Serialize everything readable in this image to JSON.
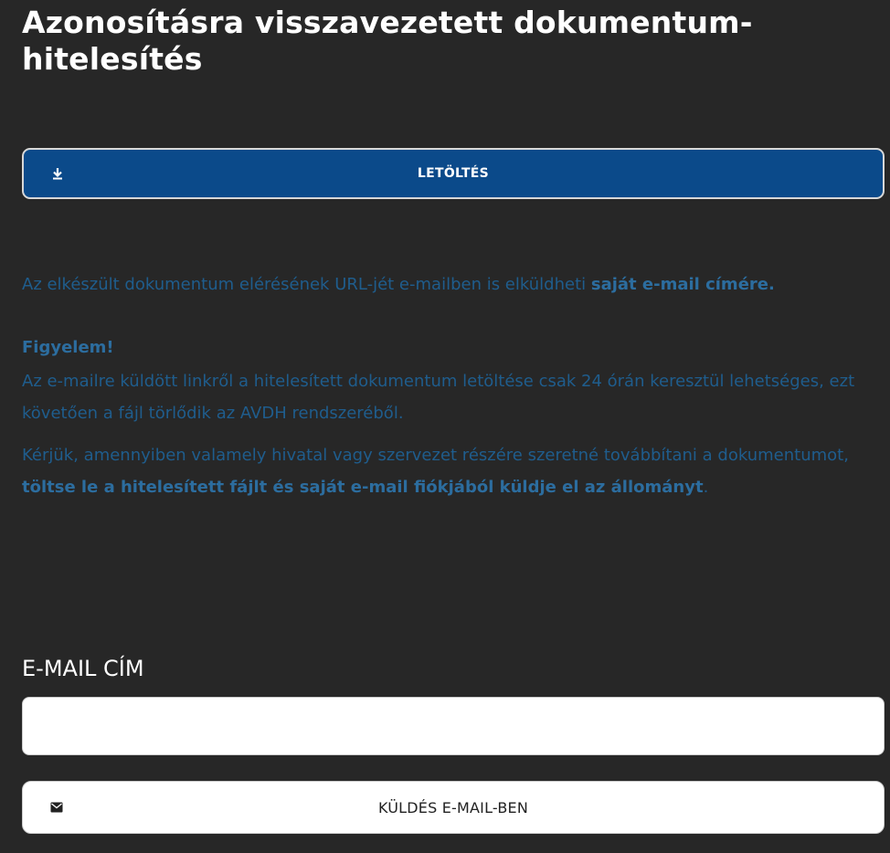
{
  "page": {
    "title": "Azonosításra visszavezetett dokumentum-hitelesítés"
  },
  "download": {
    "label": "LETÖLTÉS",
    "icon": "download-icon"
  },
  "info": {
    "p1_text": "Az elkészült dokumentum elérésének URL-jét e-mailben is elküldheti ",
    "p1_bold": "saját e-mail címére.",
    "warning_title": "Figyelem!",
    "p2_text": "Az e-mailre küldött linkről a hitelesített dokumentum letöltése csak 24 órán keresztül lehetséges, ezt követően a fájl törlődik az AVDH rendszeréből.",
    "p3_text": "Kérjük, amennyiben valamely hivatal vagy szervezet részére szeretné továbbítani a dokumentumot, ",
    "p3_bold": "töltse le a hitelesített fájlt és saját e-mail fiókjából küldje el az állományt",
    "p3_end": "."
  },
  "email": {
    "label": "E-MAIL CÍM",
    "value": "",
    "placeholder": ""
  },
  "send": {
    "label": "KÜLDÉS E-MAIL-BEN",
    "icon": "envelope-icon"
  },
  "colors": {
    "background": "#272727",
    "primary_button": "#0b4a8a",
    "info_text": "#1f5d8d"
  }
}
